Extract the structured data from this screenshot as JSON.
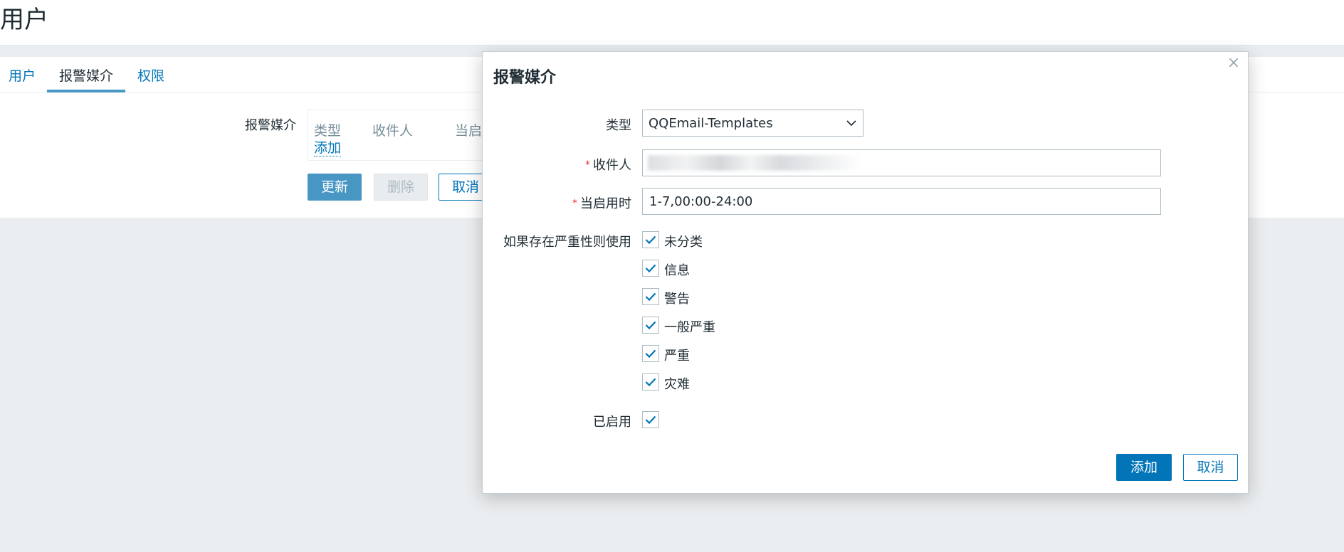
{
  "page": {
    "title": "用户",
    "tabs": [
      {
        "label": "用户"
      },
      {
        "label": "报警媒介"
      },
      {
        "label": "权限"
      }
    ],
    "media_form": {
      "label": "报警媒介",
      "columns": [
        "类型",
        "收件人",
        "当启"
      ],
      "add_link": "添加",
      "buttons": {
        "update": "更新",
        "delete": "删除",
        "cancel": "取消"
      }
    }
  },
  "dialog": {
    "title": "报警媒介",
    "close_symbol": "×",
    "fields": {
      "type": {
        "label": "类型",
        "value": "QQEmail-Templates"
      },
      "recipient": {
        "label": "收件人",
        "required_mark": "*",
        "value": ""
      },
      "when_active": {
        "label": "当启用时",
        "required_mark": "*",
        "value": "1-7,00:00-24:00"
      },
      "severity": {
        "label": "如果存在严重性则使用",
        "options": [
          {
            "label": "未分类",
            "checked": true
          },
          {
            "label": "信息",
            "checked": true
          },
          {
            "label": "警告",
            "checked": true
          },
          {
            "label": "一般严重",
            "checked": true
          },
          {
            "label": "严重",
            "checked": true
          },
          {
            "label": "灾难",
            "checked": true
          }
        ]
      },
      "enabled": {
        "label": "已启用",
        "checked": true
      }
    },
    "buttons": {
      "add": "添加",
      "cancel": "取消"
    }
  },
  "colors": {
    "accent": "#0275b8",
    "tab_underline": "#4796c4",
    "required": "#e33734",
    "background": "#ebeef0"
  }
}
